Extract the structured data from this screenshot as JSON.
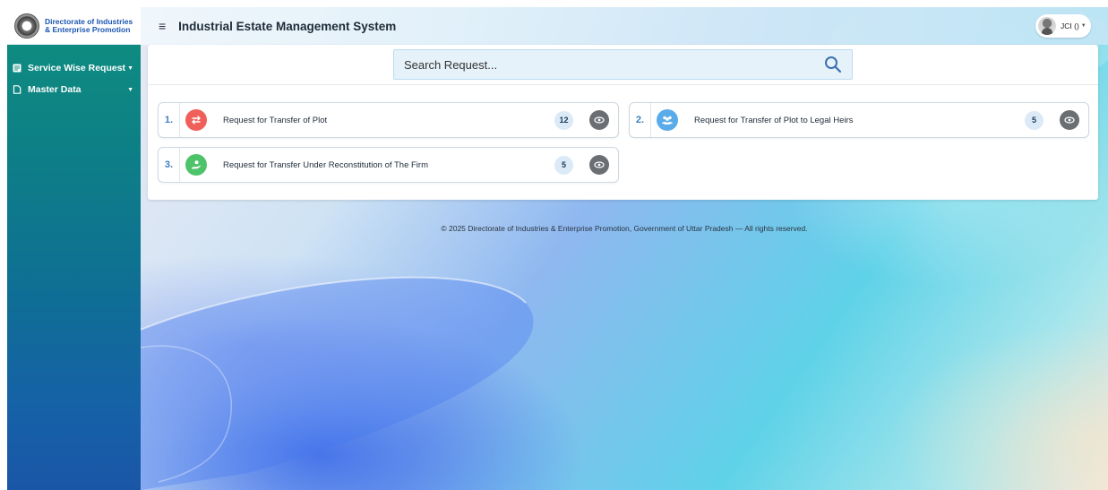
{
  "brand": {
    "line1": "Directorate of Industries",
    "line2": "& Enterprise Promotion"
  },
  "sidebar": {
    "items": [
      {
        "label": "Service Wise Request",
        "icon": "list-icon"
      },
      {
        "label": "Master Data",
        "icon": "document-icon"
      }
    ]
  },
  "header": {
    "title": "Industrial Estate Management System",
    "user_name": "JCI ()"
  },
  "search": {
    "placeholder": "Search Request..."
  },
  "requests": [
    {
      "number": "1.",
      "label": "Request for Transfer of Plot",
      "count": "12",
      "icon": "transfer-icon",
      "color": "#f0605a"
    },
    {
      "number": "2.",
      "label": "Request for Transfer of Plot to Legal Heirs",
      "count": "5",
      "icon": "group-icon",
      "color": "#5aabea"
    },
    {
      "number": "3.",
      "label": "Request for Transfer Under Reconstitution of The Firm",
      "count": "5",
      "icon": "user-hand-icon",
      "color": "#4fc36a"
    }
  ],
  "footer": {
    "copyright": "© 2025 Directorate of Industries & Enterprise Promotion, Government of Uttar Pradesh — All rights reserved."
  },
  "colors": {
    "sidebar_top": "#0f8f7e",
    "sidebar_bottom": "#1a56a6",
    "view_button": "#6b6f73",
    "count_badge": "#dbeaf6"
  }
}
